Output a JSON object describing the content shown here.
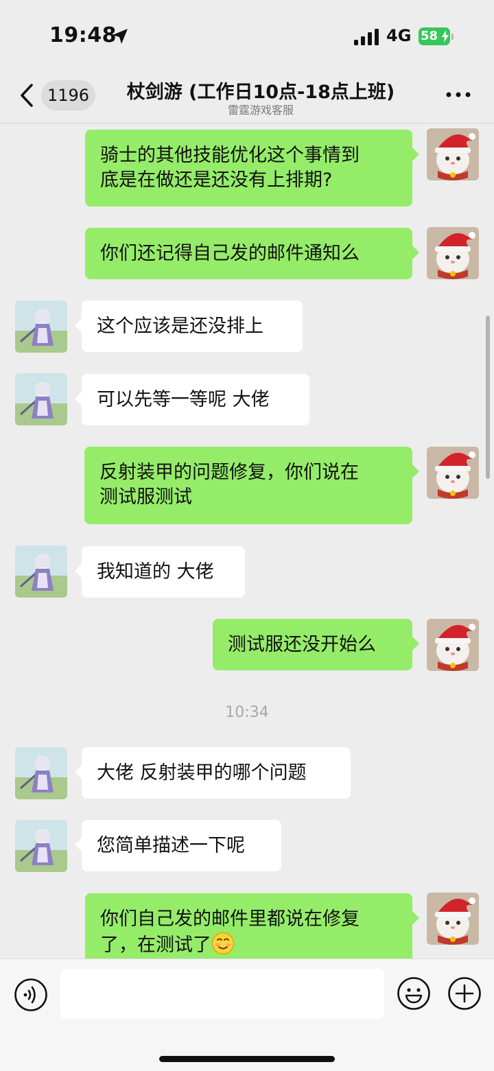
{
  "status": {
    "time": "19:48",
    "network": "4G",
    "battery": "58"
  },
  "header": {
    "unread_count": "1196",
    "title": "杖剑游 (工作日10点-18点上班)",
    "subtitle": "雷霆游戏客服"
  },
  "messages": [
    {
      "from": "me",
      "lines": [
        "骑士的其他技能优化这个事情到",
        "底是在做还是还没有上排期?"
      ]
    },
    {
      "from": "me",
      "lines": [
        "你们还记得自己发的邮件通知么"
      ]
    },
    {
      "from": "them",
      "lines": [
        "这个应该是还没排上"
      ]
    },
    {
      "from": "them",
      "lines": [
        "可以先等一等呢 大佬"
      ]
    },
    {
      "from": "me",
      "lines": [
        "反射装甲的问题修复，你们说在",
        "测试服测试"
      ]
    },
    {
      "from": "them",
      "lines": [
        "我知道的 大佬"
      ]
    },
    {
      "from": "me",
      "lines": [
        "测试服还没开始么"
      ]
    },
    {
      "type": "timestamp",
      "text": "10:34"
    },
    {
      "from": "them",
      "lines": [
        "大佬 反射装甲的哪个问题"
      ]
    },
    {
      "from": "them",
      "lines": [
        "您简单描述一下呢"
      ]
    },
    {
      "from": "me",
      "lines": [
        "你们自己发的邮件里都说在修复",
        "了，在测试了"
      ],
      "emoji": "smiling-face-emoji"
    }
  ],
  "input": {
    "value": "",
    "placeholder": ""
  },
  "icons": {
    "back": "chevron-left-icon",
    "more": "more-dots-icon",
    "voice": "voice-icon",
    "emoji": "emoji-icon",
    "plus": "plus-icon"
  },
  "colors": {
    "my_bubble": "#95ec69",
    "their_bubble": "#ffffff",
    "background": "#ededed",
    "battery": "#34c759"
  }
}
